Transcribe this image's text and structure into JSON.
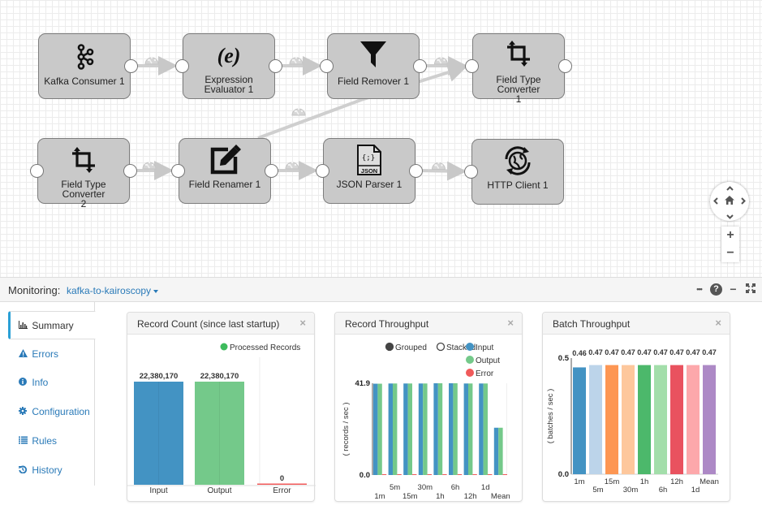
{
  "pipeline": {
    "nodes": [
      {
        "id": "kafka",
        "label": "Kafka Consumer 1",
        "icon": "kafka-icon",
        "has_input": false,
        "has_output": true
      },
      {
        "id": "expr",
        "label": "Expression Evaluator 1",
        "label_lines": [
          "Expression",
          "Evaluator 1"
        ],
        "icon": "expression-icon",
        "has_input": true,
        "has_output": true
      },
      {
        "id": "remover",
        "label": "Field Remover 1",
        "icon": "filter-funnel-icon",
        "has_input": true,
        "has_output": true
      },
      {
        "id": "ftc1",
        "label": "Field Type Converter 1",
        "label_lines": [
          "Field Type Converter",
          "1"
        ],
        "icon": "crop-convert-icon",
        "has_input": true,
        "has_output": true
      },
      {
        "id": "ftc2",
        "label": "Field Type Converter 2",
        "label_lines": [
          "Field Type Converter",
          "2"
        ],
        "icon": "crop-convert-icon",
        "has_input": true,
        "has_output": true
      },
      {
        "id": "renamer",
        "label": "Field Renamer 1",
        "icon": "edit-pencil-icon",
        "has_input": true,
        "has_output": true
      },
      {
        "id": "json",
        "label": "JSON Parser 1",
        "icon": "json-file-icon",
        "has_input": true,
        "has_output": true
      },
      {
        "id": "http",
        "label": "HTTP Client 1",
        "icon": "http-globe-sync-icon",
        "has_input": true,
        "has_output": false
      }
    ],
    "edges": [
      {
        "from": "kafka",
        "to": "expr"
      },
      {
        "from": "expr",
        "to": "remover"
      },
      {
        "from": "remover",
        "to": "ftc1"
      },
      {
        "from": "renamer",
        "to": "ftc1"
      },
      {
        "from": "ftc2",
        "to": "renamer"
      },
      {
        "from": "renamer",
        "to": "json"
      },
      {
        "from": "json",
        "to": "http"
      }
    ]
  },
  "canvas_controls": {
    "pan_up": "^",
    "pan_down": "v",
    "pan_left": "<",
    "pan_right": ">",
    "home": "⌂",
    "zoom_in": "+",
    "zoom_out": "−"
  },
  "monitor_bar": {
    "title": "Monitoring:",
    "pipeline_name": "kafka-to-kairoscopy",
    "icons": [
      "more-icon",
      "help-icon",
      "minimize-icon",
      "expand-icon"
    ],
    "help_glyph": "?",
    "more_glyph": "•••",
    "minimize_glyph": "−",
    "expand_glyph": "⤢"
  },
  "sidenav": {
    "items": [
      {
        "label": "Summary",
        "icon": "bar-chart-icon",
        "glyph": "▥",
        "active": true
      },
      {
        "label": "Errors",
        "icon": "warning-icon",
        "glyph": "▲",
        "active": false
      },
      {
        "label": "Info",
        "icon": "info-icon",
        "glyph": "ⓘ",
        "active": false
      },
      {
        "label": "Configuration",
        "icon": "gear-icon",
        "glyph": "✱",
        "active": false
      },
      {
        "label": "Rules",
        "icon": "list-icon",
        "glyph": "≣",
        "active": false
      },
      {
        "label": "History",
        "icon": "history-icon",
        "glyph": "↺",
        "active": false
      }
    ]
  },
  "panels": [
    {
      "title": "Record Count (since last startup)",
      "close": "×"
    },
    {
      "title": "Record Throughput",
      "close": "×"
    },
    {
      "title": "Batch Throughput",
      "close": "×"
    }
  ],
  "colors": {
    "input": "#4393c3",
    "output": "#74c98a",
    "error": "#f05a5a",
    "link": "#2a7ab8",
    "accent": "#2aa0d6"
  },
  "chart_data": [
    {
      "type": "bar",
      "title": "Record Count (since last startup)",
      "legend": [
        "Processed Records"
      ],
      "legend_color": "#3dbb5c",
      "categories": [
        "Input",
        "Output",
        "Error"
      ],
      "values": [
        22380170,
        22380170,
        0
      ],
      "value_labels": [
        "22,380,170",
        "22,380,170",
        "0"
      ],
      "colors": [
        "#4393c3",
        "#74c98a",
        "#f05a5a"
      ]
    },
    {
      "type": "bar",
      "title": "Record Throughput",
      "mode_options": [
        {
          "label": "Grouped",
          "selected": true
        },
        {
          "label": "Stacked",
          "selected": false
        }
      ],
      "ylabel": "( records / sec )",
      "ylim": [
        0,
        41.9
      ],
      "yticks": [
        "0.0",
        "41.9"
      ],
      "categories": [
        "1m",
        "5m",
        "15m",
        "30m",
        "1h",
        "6h",
        "12h",
        "1d",
        "Mean"
      ],
      "series": [
        {
          "name": "Input",
          "color": "#4393c3",
          "values": [
            41.7,
            41.8,
            41.8,
            41.8,
            41.9,
            41.9,
            41.8,
            41.8,
            21.6
          ]
        },
        {
          "name": "Output",
          "color": "#74c98a",
          "values": [
            41.7,
            41.8,
            41.8,
            41.8,
            41.9,
            41.9,
            41.8,
            41.8,
            21.6
          ]
        },
        {
          "name": "Error",
          "color": "#f05a5a",
          "values": [
            0,
            0,
            0,
            0,
            0,
            0,
            0,
            0,
            0
          ]
        }
      ]
    },
    {
      "type": "bar",
      "title": "Batch Throughput",
      "ylabel": "( batches / sec )",
      "ylim": [
        0,
        0.5
      ],
      "yticks": [
        "0.0",
        "0.5"
      ],
      "categories": [
        "1m",
        "5m",
        "15m",
        "30m",
        "1h",
        "6h",
        "12h",
        "1d",
        "Mean"
      ],
      "values": [
        0.46,
        0.47,
        0.47,
        0.47,
        0.47,
        0.47,
        0.47,
        0.47,
        0.47
      ],
      "value_labels": [
        "0.46",
        "0.47",
        "0.47",
        "0.47",
        "0.47",
        "0.47",
        "0.47",
        "0.47",
        "0.47"
      ],
      "colors": [
        "#4393c3",
        "#bcd4ea",
        "#fd9653",
        "#fdc79c",
        "#4cb86b",
        "#a3deaa",
        "#e9525f",
        "#fda8ab",
        "#ad89c6"
      ]
    }
  ]
}
